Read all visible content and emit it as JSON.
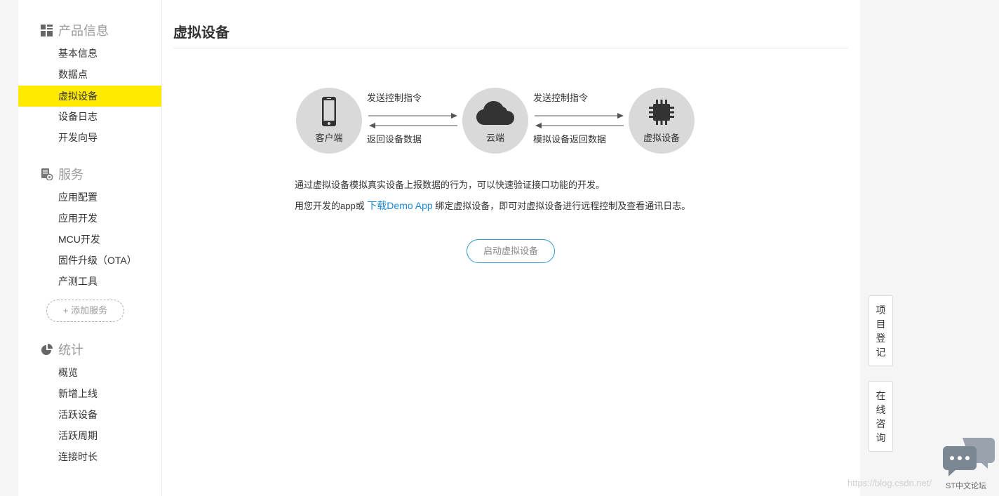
{
  "sidebar": {
    "groups": [
      {
        "title": "产品信息",
        "icon": "grid-icon",
        "items": [
          "基本信息",
          "数据点",
          "虚拟设备",
          "设备日志",
          "开发向导"
        ]
      },
      {
        "title": "服务",
        "icon": "service-icon",
        "items": [
          "应用配置",
          "应用开发",
          "MCU开发",
          "固件升级（OTA）",
          "产测工具"
        ]
      },
      {
        "title": "统计",
        "icon": "pie-chart-icon",
        "items": [
          "概览",
          "新增上线",
          "活跃设备",
          "活跃周期",
          "连接时长"
        ]
      }
    ],
    "active_item": "虚拟设备",
    "add_service_label": "+ 添加服务"
  },
  "main": {
    "title": "虚拟设备",
    "diagram": {
      "client_label": "客户端",
      "cloud_label": "云端",
      "device_label": "虚拟设备",
      "send_cmd_1": "发送控制指令",
      "return_data_1": "返回设备数据",
      "send_cmd_2": "发送控制指令",
      "return_data_2": "模拟设备返回数据"
    },
    "desc_line1": "通过虚拟设备模拟真实设备上报数据的行为，可以快速验证接口功能的开发。",
    "desc_line2_prefix": "用您开发的app或 ",
    "desc_link": "下载Demo App",
    "desc_line2_suffix": " 绑定虚拟设备，即可对虚拟设备进行远程控制及查看通讯日志。",
    "start_button": "启动虚拟设备"
  },
  "float_buttons": {
    "register": [
      "项",
      "目",
      "登",
      "记"
    ],
    "consult": [
      "在",
      "线",
      "咨",
      "询"
    ]
  },
  "watermark": {
    "url": "https://blog.csdn.net/",
    "logo_label": "ST中文论坛"
  },
  "colors": {
    "active_bg": "#ffea00",
    "link": "#1d8ad6",
    "button_border": "#2c9bd3"
  }
}
